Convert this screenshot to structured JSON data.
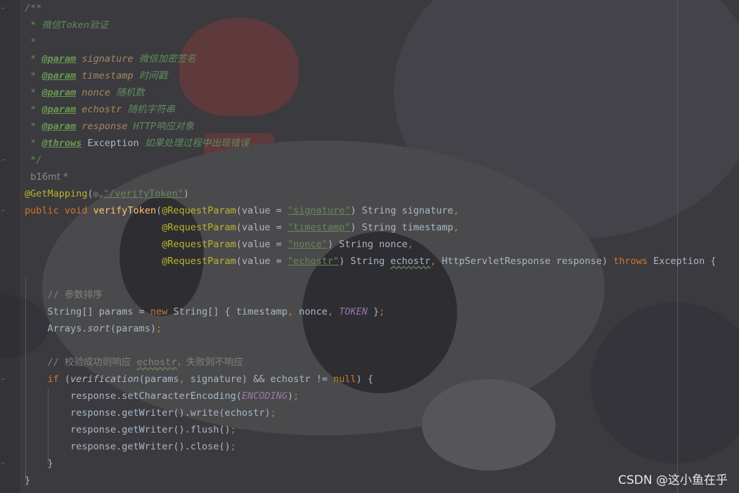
{
  "editor": {
    "author_hint": "b16mt *",
    "lines": [
      [
        {
          "c": "doc",
          "t": "/**"
        }
      ],
      [
        {
          "c": "doc",
          "t": " * 微信Token验证"
        }
      ],
      [
        {
          "c": "doc",
          "t": " *"
        }
      ],
      [
        {
          "c": "doc",
          "t": " * "
        },
        {
          "c": "doc-tag",
          "t": "@param"
        },
        {
          "c": "doc-param",
          "t": " signature"
        },
        {
          "c": "doc-text",
          "t": " 微信加密签名"
        }
      ],
      [
        {
          "c": "doc",
          "t": " * "
        },
        {
          "c": "doc-tag",
          "t": "@param"
        },
        {
          "c": "doc-param",
          "t": " timestamp"
        },
        {
          "c": "doc-text",
          "t": " 时间戳"
        }
      ],
      [
        {
          "c": "doc",
          "t": " * "
        },
        {
          "c": "doc-tag",
          "t": "@param"
        },
        {
          "c": "doc-param",
          "t": " nonce"
        },
        {
          "c": "doc-text",
          "t": " 随机数"
        }
      ],
      [
        {
          "c": "doc",
          "t": " * "
        },
        {
          "c": "doc-tag",
          "t": "@param"
        },
        {
          "c": "doc-param",
          "t": " echostr"
        },
        {
          "c": "doc-text",
          "t": " 随机字符串"
        }
      ],
      [
        {
          "c": "doc",
          "t": " * "
        },
        {
          "c": "doc-tag",
          "t": "@param"
        },
        {
          "c": "doc-param",
          "t": " response"
        },
        {
          "c": "doc-text",
          "t": " HTTP响应对象"
        }
      ],
      [
        {
          "c": "doc",
          "t": " * "
        },
        {
          "c": "doc-tag",
          "t": "@throws"
        },
        {
          "c": "plain",
          "t": " Exception"
        },
        {
          "c": "doc-text",
          "t": " 如果处理过程中出现错误"
        }
      ],
      [
        {
          "c": "doc",
          "t": " */"
        }
      ],
      [
        {
          "c": "author-hint",
          "t": "  b16mt *"
        }
      ],
      [
        {
          "c": "anno",
          "t": "@GetMapping"
        },
        {
          "c": "plain",
          "t": "("
        },
        {
          "c": "globe",
          "t": "◎⌄"
        },
        {
          "c": "str",
          "t": "\"/verifyToken\""
        },
        {
          "c": "plain",
          "t": ")"
        }
      ],
      [
        {
          "c": "kw",
          "t": "public void "
        },
        {
          "c": "method",
          "t": "verifyToken"
        },
        {
          "c": "plain",
          "t": "("
        },
        {
          "c": "anno",
          "t": "@RequestParam"
        },
        {
          "c": "plain",
          "t": "(value = "
        },
        {
          "c": "str",
          "t": "\"signature\""
        },
        {
          "c": "plain",
          "t": ") String signature"
        },
        {
          "c": "kw",
          "t": ","
        }
      ],
      [
        {
          "c": "plain",
          "t": "                        "
        },
        {
          "c": "anno",
          "t": "@RequestParam"
        },
        {
          "c": "plain",
          "t": "(value = "
        },
        {
          "c": "str",
          "t": "\"timestamp\""
        },
        {
          "c": "plain",
          "t": ") String timestamp"
        },
        {
          "c": "kw",
          "t": ","
        }
      ],
      [
        {
          "c": "plain",
          "t": "                        "
        },
        {
          "c": "anno",
          "t": "@RequestParam"
        },
        {
          "c": "plain",
          "t": "(value = "
        },
        {
          "c": "str",
          "t": "\"nonce\""
        },
        {
          "c": "plain",
          "t": ") String nonce"
        },
        {
          "c": "kw",
          "t": ","
        }
      ],
      [
        {
          "c": "plain",
          "t": "                        "
        },
        {
          "c": "anno",
          "t": "@RequestParam"
        },
        {
          "c": "plain",
          "t": "(value = "
        },
        {
          "c": "str",
          "t": "\"echostr\""
        },
        {
          "c": "plain",
          "t": ") String "
        },
        {
          "c": "plain squiggle",
          "t": "echostr"
        },
        {
          "c": "kw",
          "t": ","
        },
        {
          "c": "plain",
          "t": " HttpServletResponse response) "
        },
        {
          "c": "kw",
          "t": "throws"
        },
        {
          "c": "plain",
          "t": " Exception {"
        }
      ],
      [
        {
          "c": "plain",
          "t": ""
        }
      ],
      [
        {
          "c": "plain",
          "t": "    "
        },
        {
          "c": "comment",
          "t": "// 参数排序"
        }
      ],
      [
        {
          "c": "plain",
          "t": "    String[] params = "
        },
        {
          "c": "kw",
          "t": "new"
        },
        {
          "c": "plain",
          "t": " String[] { timestamp"
        },
        {
          "c": "kw",
          "t": ","
        },
        {
          "c": "plain",
          "t": " nonce"
        },
        {
          "c": "kw",
          "t": ","
        },
        {
          "c": "plain",
          "t": " "
        },
        {
          "c": "const",
          "t": "TOKEN"
        },
        {
          "c": "plain",
          "t": " }"
        },
        {
          "c": "kw",
          "t": ";"
        }
      ],
      [
        {
          "c": "plain",
          "t": "    Arrays."
        },
        {
          "c": "static-call",
          "t": "sort"
        },
        {
          "c": "plain",
          "t": "(params)"
        },
        {
          "c": "kw",
          "t": ";"
        }
      ],
      [
        {
          "c": "plain",
          "t": ""
        }
      ],
      [
        {
          "c": "plain",
          "t": "    "
        },
        {
          "c": "comment",
          "t": "// 校验成功则响应 "
        },
        {
          "c": "comment squiggle",
          "t": "echostr"
        },
        {
          "c": "comment",
          "t": "，失败则不响应"
        }
      ],
      [
        {
          "c": "plain",
          "t": "    "
        },
        {
          "c": "kw",
          "t": "if"
        },
        {
          "c": "plain",
          "t": " ("
        },
        {
          "c": "static-call",
          "t": "verification"
        },
        {
          "c": "plain",
          "t": "(params"
        },
        {
          "c": "kw",
          "t": ","
        },
        {
          "c": "plain",
          "t": " signature) && echostr != "
        },
        {
          "c": "kw",
          "t": "null"
        },
        {
          "c": "plain",
          "t": ") {"
        }
      ],
      [
        {
          "c": "plain",
          "t": "        response.setCharacterEncoding("
        },
        {
          "c": "const",
          "t": "ENCODING"
        },
        {
          "c": "plain",
          "t": ")"
        },
        {
          "c": "kw",
          "t": ";"
        }
      ],
      [
        {
          "c": "plain",
          "t": "        response.getWriter().write(echostr)"
        },
        {
          "c": "kw",
          "t": ";"
        }
      ],
      [
        {
          "c": "plain",
          "t": "        response.getWriter().flush()"
        },
        {
          "c": "kw",
          "t": ";"
        }
      ],
      [
        {
          "c": "plain",
          "t": "        response.getWriter().close()"
        },
        {
          "c": "kw",
          "t": ";"
        }
      ],
      [
        {
          "c": "plain",
          "t": "    }"
        }
      ],
      [
        {
          "c": "plain",
          "t": "}"
        }
      ]
    ]
  },
  "watermark": "CSDN @这小鱼在乎"
}
